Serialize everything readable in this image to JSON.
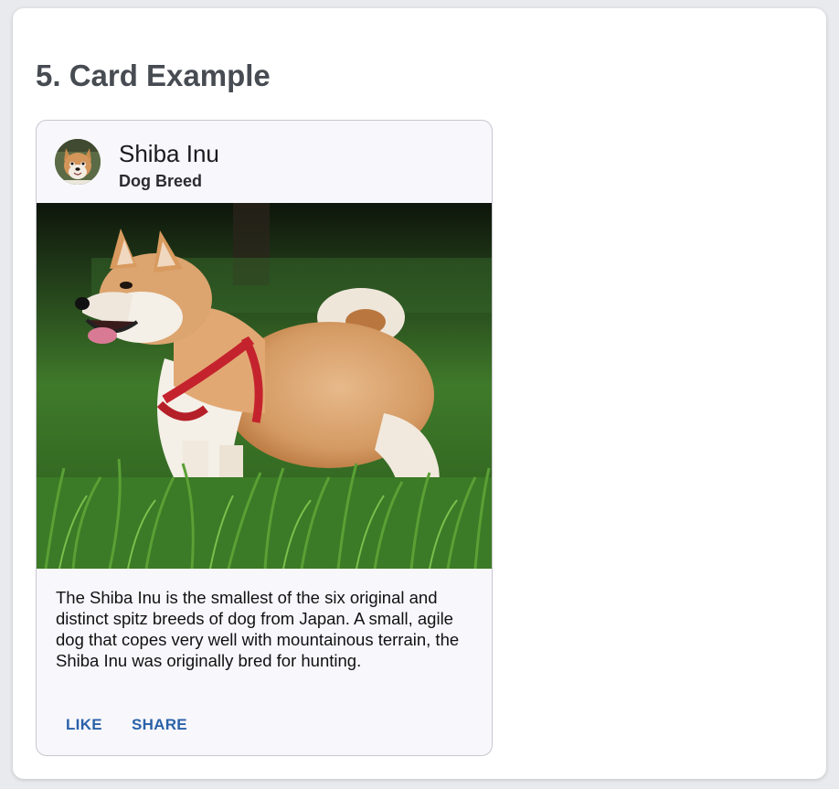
{
  "section": {
    "title": "5. Card Example"
  },
  "card": {
    "title": "Shiba Inu",
    "subtitle": "Dog Breed",
    "avatar_icon": "shiba-inu-avatar",
    "image_icon": "shiba-inu-photo",
    "description": "The Shiba Inu is the smallest of the six original and distinct spitz breeds of dog from Japan. A small, agile dog that copes very well with mountainous terrain, the Shiba Inu was originally bred for hunting.",
    "actions": {
      "like_label": "LIKE",
      "share_label": "SHARE"
    }
  },
  "colors": {
    "page_background": "#e9eaee",
    "panel_background": "#ffffff",
    "card_background": "#f8f7fc",
    "title_color": "#474b52",
    "action_color": "#2a62a8"
  }
}
